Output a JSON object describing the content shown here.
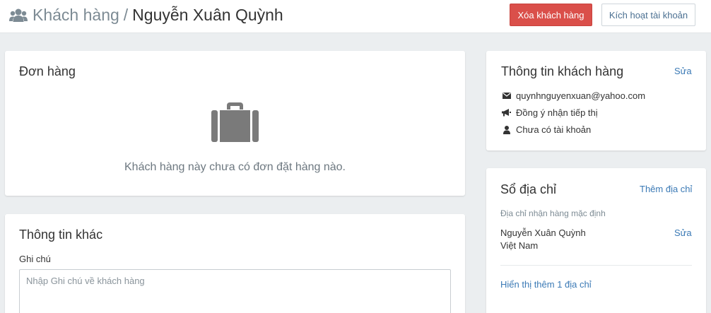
{
  "header": {
    "breadcrumb_parent": "Khách hàng",
    "breadcrumb_separator": "/",
    "customer_name": "Nguyễn Xuân Quỳnh",
    "delete_button": "Xóa khách hàng",
    "activate_button": "Kích hoạt tài khoản"
  },
  "orders": {
    "title": "Đơn hàng",
    "empty_message": "Khách hàng này chưa có đơn đặt hàng nào."
  },
  "other_info": {
    "title": "Thông tin khác",
    "note_label": "Ghi chú",
    "note_placeholder": "Nhập Ghi chú về khách hàng",
    "note_value": ""
  },
  "customer_info": {
    "title": "Thông tin khách hàng",
    "edit_link": "Sửa",
    "email": "quynhnguyenxuan@yahoo.com",
    "marketing": "Đồng ý nhận tiếp thị",
    "account_status": "Chưa có tài khoản"
  },
  "address_book": {
    "title": "Sổ địa chỉ",
    "add_link": "Thêm địa chỉ",
    "default_label": "Địa chỉ nhận hàng mặc định",
    "name": "Nguyễn Xuân Quỳnh",
    "country": "Việt Nam",
    "edit_link": "Sửa",
    "show_more_link": "Hiển thị thêm 1 địa chỉ"
  },
  "colors": {
    "danger": "#da4f4a",
    "link": "#3a79b5",
    "muted": "#7d8b94",
    "background": "#ebeef0"
  }
}
